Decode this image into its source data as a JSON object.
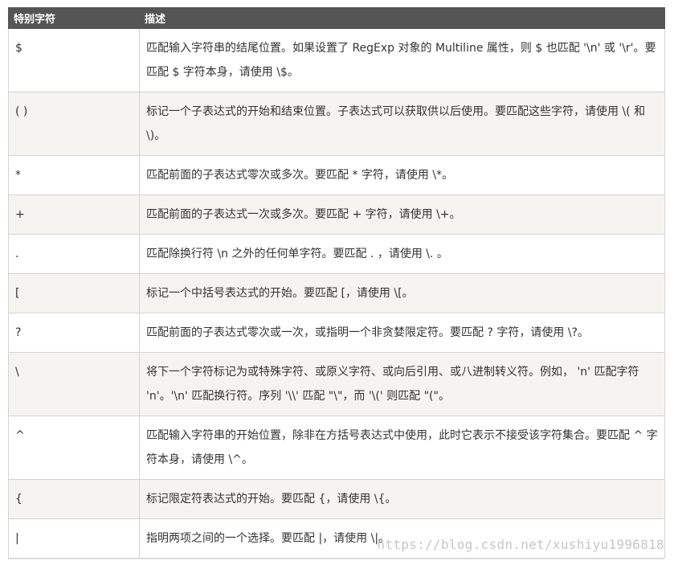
{
  "table": {
    "header": {
      "col1": "特别字符",
      "col2": "描述"
    },
    "rows": [
      {
        "char": "$",
        "desc": "匹配输入字符串的结尾位置。如果设置了 RegExp 对象的 Multiline 属性，则 $ 也匹配 '\\n' 或 '\\r'。要匹配 $ 字符本身，请使用 \\$。"
      },
      {
        "char": "( )",
        "desc": "标记一个子表达式的开始和结束位置。子表达式可以获取供以后使用。要匹配这些字符，请使用 \\( 和 \\)。"
      },
      {
        "char": "*",
        "desc": "匹配前面的子表达式零次或多次。要匹配 * 字符，请使用 \\*。"
      },
      {
        "char": "+",
        "desc": "匹配前面的子表达式一次或多次。要匹配 + 字符，请使用 \\+。"
      },
      {
        "char": ".",
        "desc": "匹配除换行符 \\n 之外的任何单字符。要匹配 . ，请使用 \\. 。"
      },
      {
        "char": "[",
        "desc": "标记一个中括号表达式的开始。要匹配 [，请使用 \\[。"
      },
      {
        "char": "?",
        "desc": "匹配前面的子表达式零次或一次，或指明一个非贪婪限定符。要匹配 ? 字符，请使用 \\?。"
      },
      {
        "char": "\\",
        "desc": "将下一个字符标记为或特殊字符、或原义字符、或向后引用、或八进制转义符。例如， 'n' 匹配字符 'n'。'\\n' 匹配换行符。序列 '\\\\' 匹配 \"\\\"，而 '\\(' 则匹配 \"(\"。"
      },
      {
        "char": "^",
        "desc": "匹配输入字符串的开始位置，除非在方括号表达式中使用，此时它表示不接受该字符集合。要匹配 ^ 字符本身，请使用 \\^。"
      },
      {
        "char": "{",
        "desc": "标记限定符表达式的开始。要匹配 {，请使用 \\{。"
      },
      {
        "char": "|",
        "desc": "指明两项之间的一个选择。要匹配 |，请使用 \\|。"
      }
    ]
  },
  "watermark": "https://blog.csdn.net/xushiyu1996818"
}
